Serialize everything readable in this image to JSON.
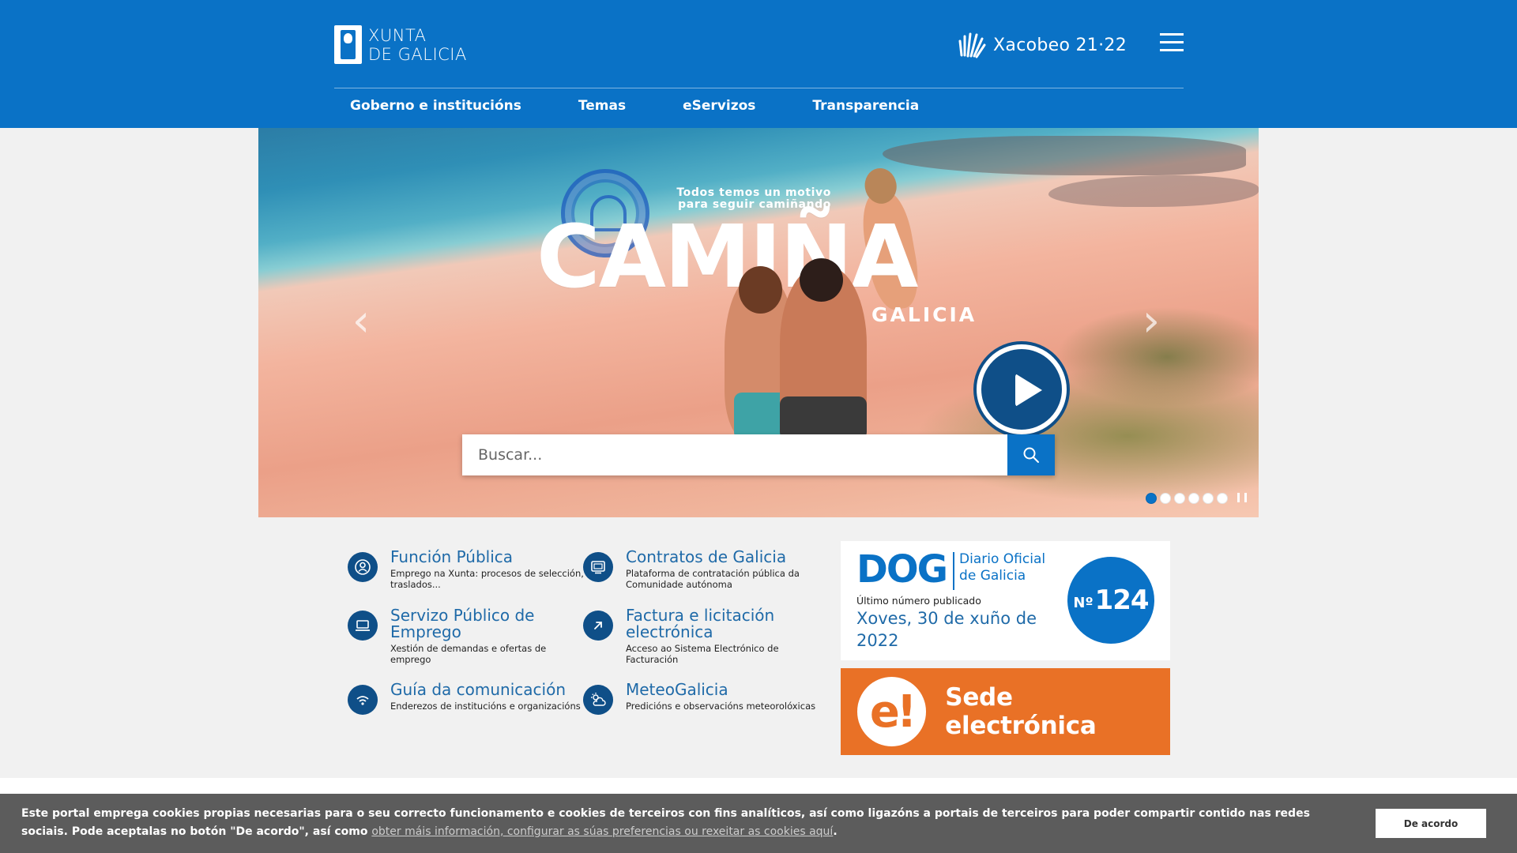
{
  "header": {
    "logo_line1": "XUNTA",
    "logo_line2": "DE GALICIA",
    "xacobeo": "Xacobeo 21·22",
    "nav": [
      "Goberno e institucións",
      "Temas",
      "eServizos",
      "Transparencia"
    ],
    "brand_color": "#0a72c6"
  },
  "hero": {
    "tagline": "Todos temos un motivo para seguir camiñando",
    "title": "CAMIÑA",
    "subtitle": "A GALICIA",
    "search_placeholder": "Buscar...",
    "slides_count": 6,
    "active_slide": 1
  },
  "links": [
    {
      "title": "Función Pública",
      "desc": "Emprego na Xunta: procesos de selección, traslados...",
      "icon": "user-icon"
    },
    {
      "title": "Contratos de Galicia",
      "desc": "Plataforma de contratación pública da Comunidade autónoma",
      "icon": "screen-icon"
    },
    {
      "title": "Servizo Público de Emprego",
      "desc": "Xestión de demandas e ofertas de emprego",
      "icon": "laptop-icon"
    },
    {
      "title": "Factura e licitación electrónica",
      "desc": "Acceso ao Sistema Electrónico de Facturación",
      "icon": "arrow-icon"
    },
    {
      "title": "Guía da comunicación",
      "desc": "Enderezos de institucións e organizacións",
      "icon": "wifi-icon"
    },
    {
      "title": "MeteoGalicia",
      "desc": "Predicións e observacións meteorolóxicas",
      "icon": "weather-icon"
    }
  ],
  "dog": {
    "abbr": "DOG",
    "name_line1": "Diario Oficial",
    "name_line2": "de Galicia",
    "label": "Último número publicado",
    "date": "Xoves, 30 de xuño de 2022",
    "num_prefix": "Nº",
    "number": "124"
  },
  "sede": {
    "icon_text": "e!",
    "label": "Sede electrónica",
    "color": "#e97126"
  },
  "cookie": {
    "text": "Este portal emprega cookies propias necesarias para o seu correcto funcionamento e cookies de terceiros con fins analíticos, así como ligazóns a portais de terceiros para poder compartir contido nas redes sociais. Pode aceptalas no botón \"De acordo\", así como ",
    "link": "obter máis información, configurar as súas preferencias ou rexeitar as cookies aquí",
    "end": ".",
    "button": "De acordo"
  }
}
